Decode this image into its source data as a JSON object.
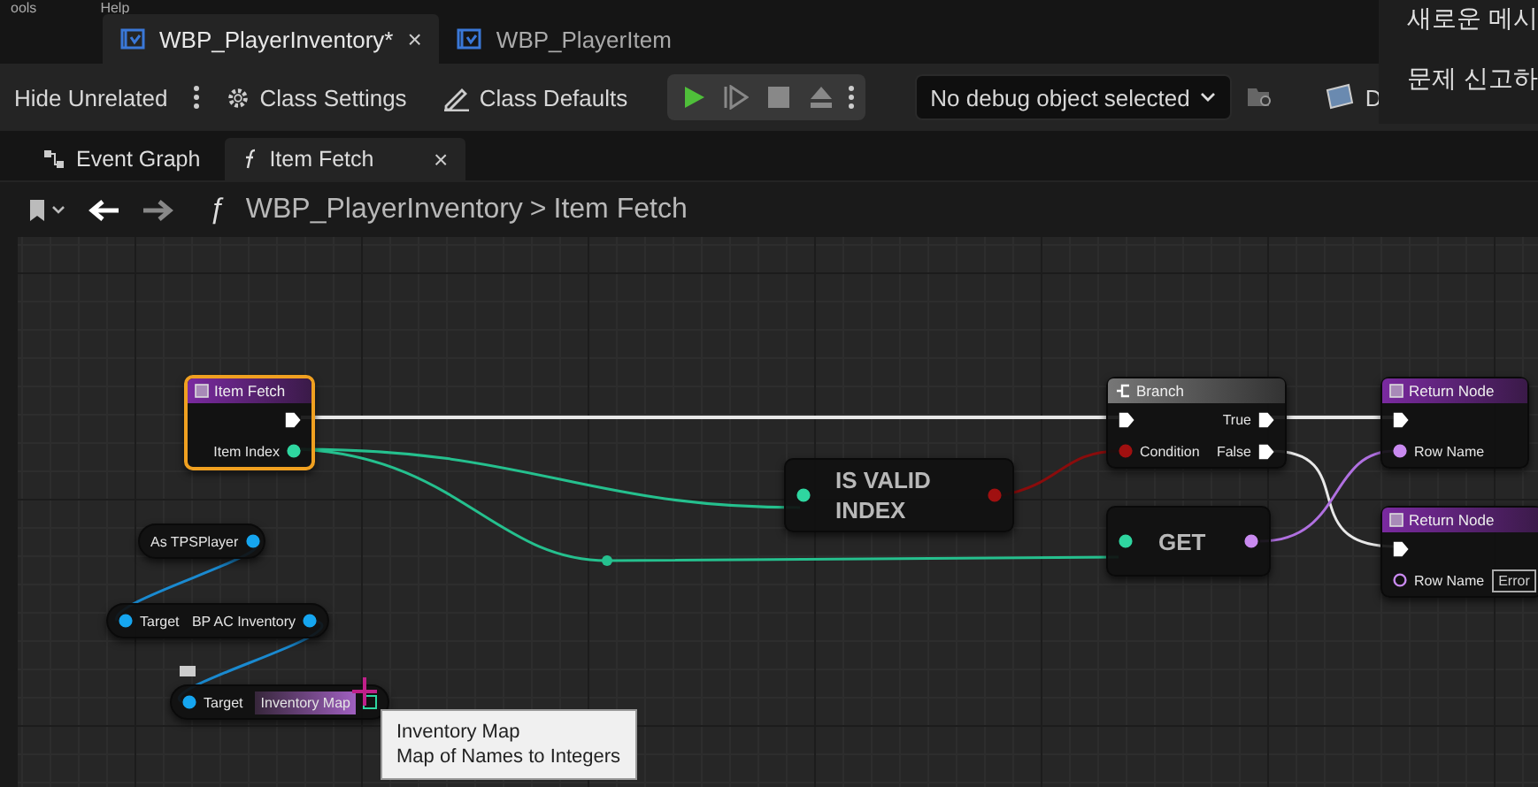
{
  "menu": [
    "ools",
    "Help"
  ],
  "document_tabs": [
    {
      "label": "WBP_PlayerInventory*",
      "selected": true,
      "close": "×"
    },
    {
      "label": "WBP_PlayerItem",
      "selected": false
    }
  ],
  "popup_menu": [
    "새로운 메시",
    "문제 신고하"
  ],
  "toolbar": {
    "hide_unrelated": "Hide Unrelated",
    "class_settings": "Class Settings",
    "class_defaults": "Class Defaults",
    "debug_object": "No debug object selected",
    "cut_button": "D"
  },
  "graph_tabs": [
    {
      "label": "Event Graph",
      "selected": false,
      "kind": "graph"
    },
    {
      "label": "Item Fetch",
      "selected": true,
      "kind": "function",
      "close": "×"
    }
  ],
  "breadcrumb": {
    "mark": "ƒ",
    "path": [
      "WBP_PlayerInventory",
      "Item Fetch"
    ],
    "separator": ">"
  },
  "nodes": [
    {
      "kind": "function",
      "title": "Item Fetch",
      "selected": true,
      "rows": [
        {
          "outputs": [
            {
              "kind": "exec",
              "connected": true
            }
          ]
        },
        {
          "outputs": [
            {
              "kind": "data",
              "label": "Item Index",
              "color": "#2fd6a0",
              "connected": true
            }
          ]
        }
      ]
    },
    {
      "kind": "pill",
      "rows": [
        {
          "outputs": [
            {
              "kind": "data",
              "label": "As TPSPlayer",
              "color": "#16a6f0",
              "connected": true
            }
          ]
        }
      ]
    },
    {
      "kind": "pill",
      "rows": [
        {
          "inputs": [
            {
              "kind": "data",
              "label": "Target",
              "color": "#16a6f0",
              "connected": true
            }
          ],
          "outputs": [
            {
              "kind": "data",
              "label": "BP AC Inventory",
              "color": "#16a6f0",
              "connected": true
            }
          ]
        }
      ]
    },
    {
      "kind": "pill",
      "rows": [
        {
          "inputs": [
            {
              "kind": "data",
              "label": "Target",
              "color": "#16a6f0",
              "connected": true
            }
          ],
          "outputs": [
            {
              "kind": "map",
              "label": "Inventory Map",
              "color": "#2fd6a0",
              "connected": false,
              "hovered": true
            }
          ]
        }
      ]
    },
    {
      "kind": "compact",
      "title": "IS VALID INDEX",
      "rows": [
        {
          "inputs": [
            {
              "kind": "data",
              "color": "#2fd6a0",
              "connected": true
            }
          ],
          "outputs": [
            {
              "kind": "data",
              "color": "#a01010",
              "connected": true
            }
          ]
        }
      ]
    },
    {
      "kind": "branch",
      "title": "Branch",
      "selected": false,
      "rows": [
        {
          "inputs": [
            {
              "kind": "exec",
              "connected": true
            }
          ],
          "outputs": [
            {
              "kind": "exec",
              "label": "True",
              "connected": true
            }
          ]
        },
        {
          "inputs": [
            {
              "kind": "data",
              "label": "Condition",
              "color": "#a01010",
              "connected": true
            }
          ],
          "outputs": [
            {
              "kind": "exec",
              "label": "False",
              "connected": true
            }
          ]
        }
      ]
    },
    {
      "kind": "compact",
      "title": "GET",
      "rows": [
        {
          "inputs": [
            {
              "kind": "data",
              "color": "#2fd6a0",
              "connected": true
            }
          ],
          "outputs": [
            {
              "kind": "data",
              "color": "#c98af0",
              "connected": true
            }
          ]
        }
      ]
    },
    {
      "kind": "function",
      "title": "Return Node",
      "selected": false,
      "rows": [
        {
          "inputs": [
            {
              "kind": "exec",
              "connected": true
            }
          ]
        },
        {
          "inputs": [
            {
              "kind": "data",
              "label": "Row Name",
              "color": "#c98af0",
              "connected": true
            }
          ]
        }
      ]
    },
    {
      "kind": "function",
      "title": "Return Node",
      "selected": false,
      "rows": [
        {
          "inputs": [
            {
              "kind": "exec",
              "connected": true
            }
          ]
        },
        {
          "inputs": [
            {
              "kind": "data",
              "label": "Row Name",
              "color": "#c98af0",
              "connected": false,
              "value": "Error"
            }
          ]
        }
      ]
    }
  ],
  "tooltip": {
    "title": "Inventory Map",
    "text": "Map of Names to Integers"
  }
}
